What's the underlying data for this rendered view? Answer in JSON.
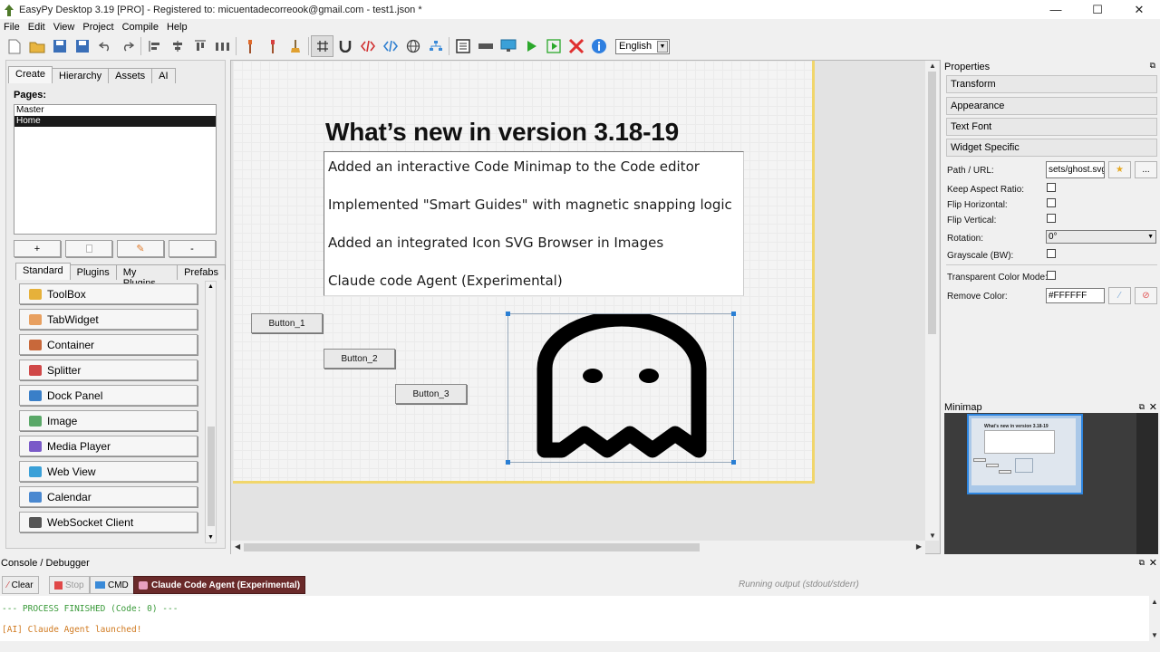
{
  "window": {
    "title": "EasyPy Desktop 3.19 [PRO] - Registered to: micuentadecorreook@gmail.com - test1.json *",
    "minimize": "—",
    "maximize": "☐",
    "close": "✕"
  },
  "menu": [
    "File",
    "Edit",
    "View",
    "Project",
    "Compile",
    "Help"
  ],
  "toolbar": {
    "language": "English"
  },
  "leftPanel": {
    "tabs": [
      "Create",
      "Hierarchy",
      "Assets",
      "AI"
    ],
    "pagesLabel": "Pages:",
    "pages": [
      "Master",
      "Home"
    ],
    "pageButtons": {
      "add": "+",
      "remove": "-"
    },
    "widgetTabs": [
      "Standard",
      "Plugins",
      "My Plugins",
      "Prefabs"
    ],
    "widgets": [
      {
        "label": "ToolBox",
        "color": "#e6b13a"
      },
      {
        "label": "TabWidget",
        "color": "#e8a060"
      },
      {
        "label": "Container",
        "color": "#c8683a"
      },
      {
        "label": "Splitter",
        "color": "#d04848"
      },
      {
        "label": "Dock Panel",
        "color": "#3a7fc8"
      },
      {
        "label": "Image",
        "color": "#5aa868"
      },
      {
        "label": "Media Player",
        "color": "#7a5ac8"
      },
      {
        "label": "Web View",
        "color": "#3aa0d8"
      },
      {
        "label": "Calendar",
        "color": "#4a88d0"
      },
      {
        "label": "WebSocket Client",
        "color": "#555555"
      }
    ]
  },
  "canvas": {
    "heading": "What’s new in version 3.18-19",
    "news": [
      "Added an interactive Code Minimap to the Code editor",
      "Implemented \"Smart Guides\" with magnetic snapping logic",
      "Added an integrated Icon SVG Browser in Images",
      "Claude code Agent (Experimental)"
    ],
    "buttons": [
      "Button_1",
      "Button_2",
      "Button_3"
    ]
  },
  "properties": {
    "header": "Properties",
    "sections": [
      "Transform",
      "Appearance",
      "Text Font",
      "Widget Specific"
    ],
    "pathLabel": "Path / URL:",
    "pathValue": "sets/ghost.svg",
    "browseLabel": "...",
    "keepAspect": "Keep Aspect Ratio:",
    "flipH": "Flip Horizontal:",
    "flipV": "Flip Vertical:",
    "rotationLabel": "Rotation:",
    "rotationValue": "0°",
    "grayscale": "Grayscale (BW):",
    "transparentMode": "Transparent Color Mode:",
    "removeColorLabel": "Remove Color:",
    "removeColorValue": "#FFFFFF"
  },
  "minimap": {
    "header": "Minimap",
    "title": "What's new in version 3.18-19"
  },
  "console": {
    "header": "Console / Debugger",
    "buttons": [
      "Clear",
      "Stop",
      "CMD",
      "Claude Code Agent (Experimental)"
    ],
    "status": "Running output (stdout/stderr)",
    "lines": [
      {
        "text": "--- PROCESS FINISHED (Code: 0) ---",
        "color": "#3a9a3a"
      },
      {
        "text": "[AI] Claude Agent launched!",
        "color": "#d07a20"
      }
    ]
  }
}
